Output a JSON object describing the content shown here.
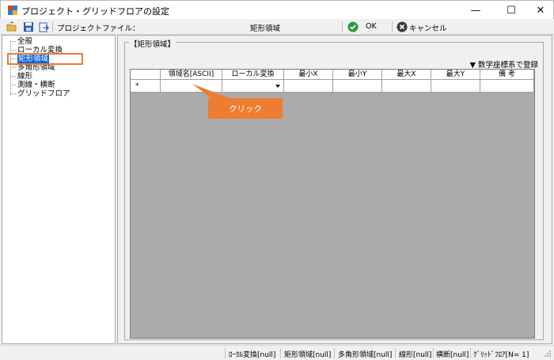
{
  "window": {
    "title": "プロジェクト・グリッドフロアの設定",
    "minimize_glyph": "—",
    "maximize_glyph": "☐",
    "close_glyph": "✕"
  },
  "toolbar": {
    "project_file_label": "プロジェクトファイル：",
    "current_item": "矩形領域",
    "ok_label": "OK",
    "cancel_label": "キャンセル"
  },
  "tree": {
    "items": [
      "全般",
      "ローカル変換",
      "矩形領域",
      "多角形領域",
      "線形",
      "測線・横断",
      "グリッドフロア"
    ],
    "selected": "矩形領域"
  },
  "panel": {
    "group_label": "【矩形領域】",
    "register_label": "▼ 数学座標系で登録",
    "columns": [
      "領域名[ASCII]",
      "ローカル変換",
      "最小X",
      "最小Y",
      "最大X",
      "最大Y",
      "備 考"
    ],
    "new_row_marker": "*"
  },
  "callout": {
    "text": "クリック"
  },
  "statusbar": {
    "items": [
      "ﾛｰｶﾙ変換[null]",
      "矩形領域[null]",
      "多角形領域[null]",
      "線形[null]",
      "横断[null]",
      "ｸﾞﾘｯﾄﾞﾌﾛｱ[N= 1]"
    ]
  },
  "colors": {
    "accent_orange": "#ed7d31",
    "selection_blue": "#0a64d6",
    "grid_background": "#ababab"
  },
  "icons": [
    "app-icon",
    "open-folder-icon",
    "save-icon",
    "export-icon",
    "ok-check-icon",
    "cancel-x-icon"
  ]
}
